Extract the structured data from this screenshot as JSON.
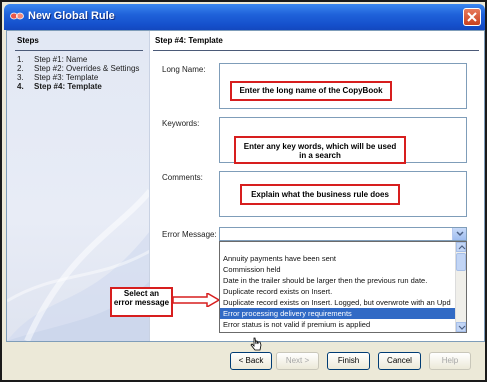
{
  "window": {
    "title": "New Global Rule"
  },
  "steps": {
    "header": "Steps",
    "items": [
      {
        "num": "1.",
        "label": "Step #1: Name"
      },
      {
        "num": "2.",
        "label": "Step #2: Overrides & Settings"
      },
      {
        "num": "3.",
        "label": "Step #3: Template"
      },
      {
        "num": "4.",
        "label": "Step #4: Template"
      }
    ]
  },
  "main": {
    "header": "Step #4: Template",
    "long_name": {
      "label": "Long Name:",
      "hint": "Enter the long name of the CopyBook"
    },
    "keywords": {
      "label": "Keywords:",
      "hint_line1": "Enter any key words, which will be used",
      "hint_line2": "in a search"
    },
    "comments": {
      "label": "Comments:",
      "hint": "Explain what the business rule does"
    },
    "error_message": {
      "label": "Error Message:",
      "value": "",
      "options": [
        "",
        "Annuity payments have been sent",
        "Commission held",
        "Date in the trailer should be larger then the previous run date.",
        "Duplicate record exists on Insert.",
        "Duplicate record exists on Insert.  Logged, but overwrote with an Upd",
        "Error processing delivery requirements",
        "Error status is not valid if premium is applied"
      ],
      "selected_index": 6
    },
    "select_callout_line1": "Select an",
    "select_callout_line2": "error message"
  },
  "buttons": {
    "back": "< Back",
    "next": "Next >",
    "finish": "Finish",
    "cancel": "Cancel",
    "help": "Help"
  },
  "colors": {
    "callout_border": "#d71e1e",
    "selection": "#316ac5",
    "titlebar": "#1f62da"
  }
}
